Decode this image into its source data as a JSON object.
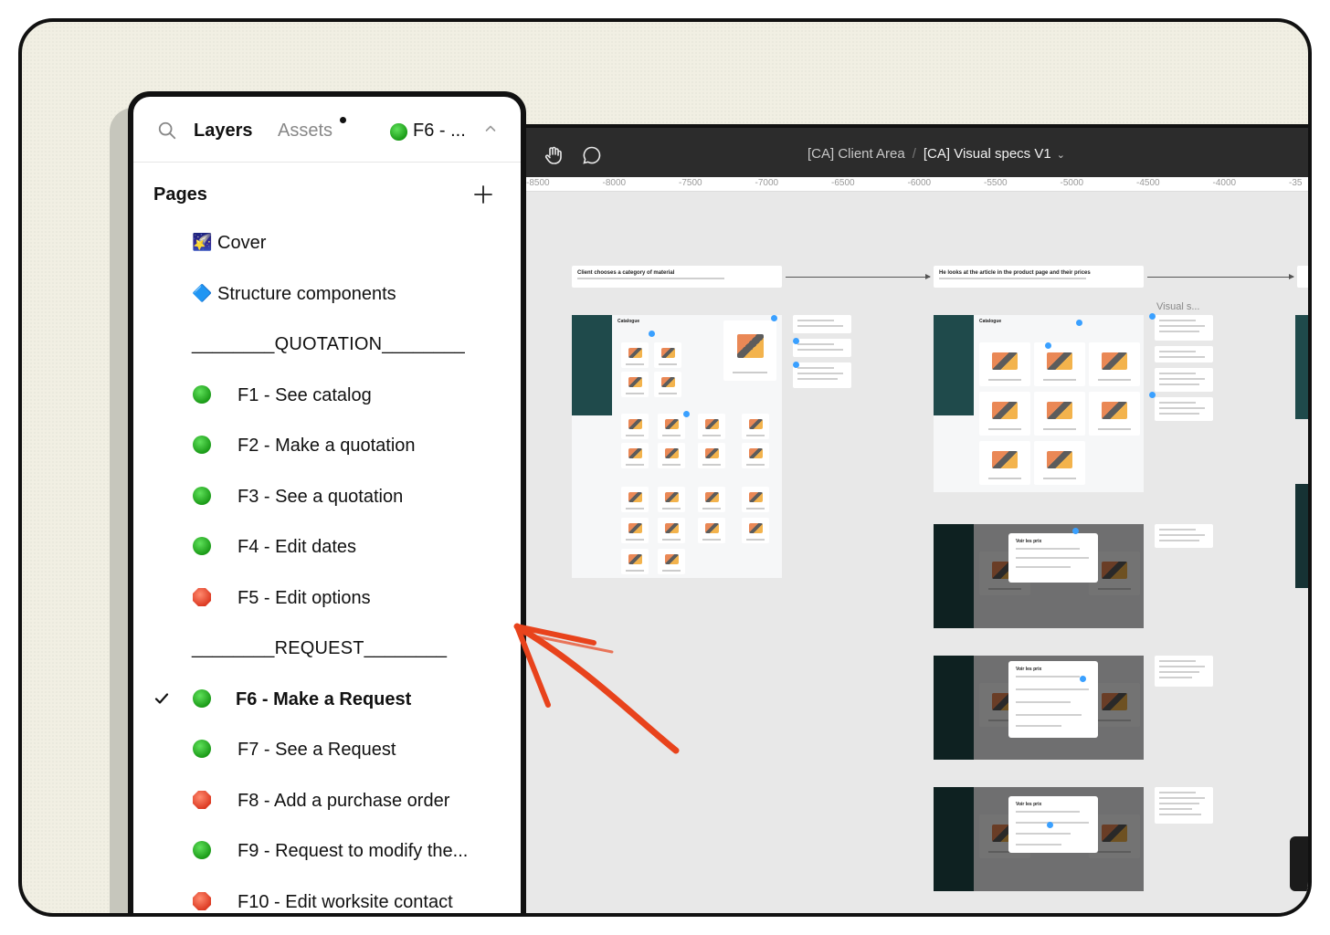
{
  "panel": {
    "tabs": {
      "layers": "Layers",
      "assets": "Assets"
    },
    "current_page": "F6 - ...",
    "pages_header": "Pages",
    "pages": [
      {
        "glyph": "🌠",
        "label": "Cover",
        "kind": "plain"
      },
      {
        "glyph": "🔷",
        "label": "Structure components",
        "kind": "plain"
      },
      {
        "label": "________QUOTATION________",
        "kind": "section"
      },
      {
        "status": "green",
        "label": "F1 - See catalog"
      },
      {
        "status": "green",
        "label": "F2 - Make a quotation"
      },
      {
        "status": "green",
        "label": "F3 - See a quotation"
      },
      {
        "status": "green",
        "label": "F4 - Edit dates"
      },
      {
        "status": "red",
        "label": "F5 - Edit options"
      },
      {
        "label": "________REQUEST________",
        "kind": "section"
      },
      {
        "status": "green",
        "label": "F6 - Make a Request",
        "current": true
      },
      {
        "status": "green",
        "label": "F7 - See a Request"
      },
      {
        "status": "red",
        "label": "F8 - Add a purchase order"
      },
      {
        "status": "green",
        "label": "F9 - Request to modify the..."
      },
      {
        "status": "red",
        "label": "F10 - Edit worksite contact"
      }
    ]
  },
  "canvas": {
    "breadcrumb_project": "[CA] Client Area",
    "breadcrumb_file": "[CA] Visual specs V1",
    "ruler_ticks": [
      "-8500",
      "-8000",
      "-7500",
      "-7000",
      "-6500",
      "-6000",
      "-5500",
      "-5000",
      "-4500",
      "-4000",
      "-35"
    ],
    "flow1_title": "Client chooses a category of material",
    "flow2_title": "He looks at the article in the product page and their prices",
    "visual_label": "Visual s..."
  },
  "colors": {
    "green": "#22b21f",
    "red": "#e5452e",
    "teal": "#1f4a4b",
    "accent_arrow": "#e8431c"
  },
  "icons": [
    "search-icon",
    "hand-icon",
    "comment-icon",
    "chevron-down-icon",
    "chevron-up-icon",
    "plus-icon",
    "check-icon",
    "green-circle-icon",
    "red-stop-icon"
  ]
}
